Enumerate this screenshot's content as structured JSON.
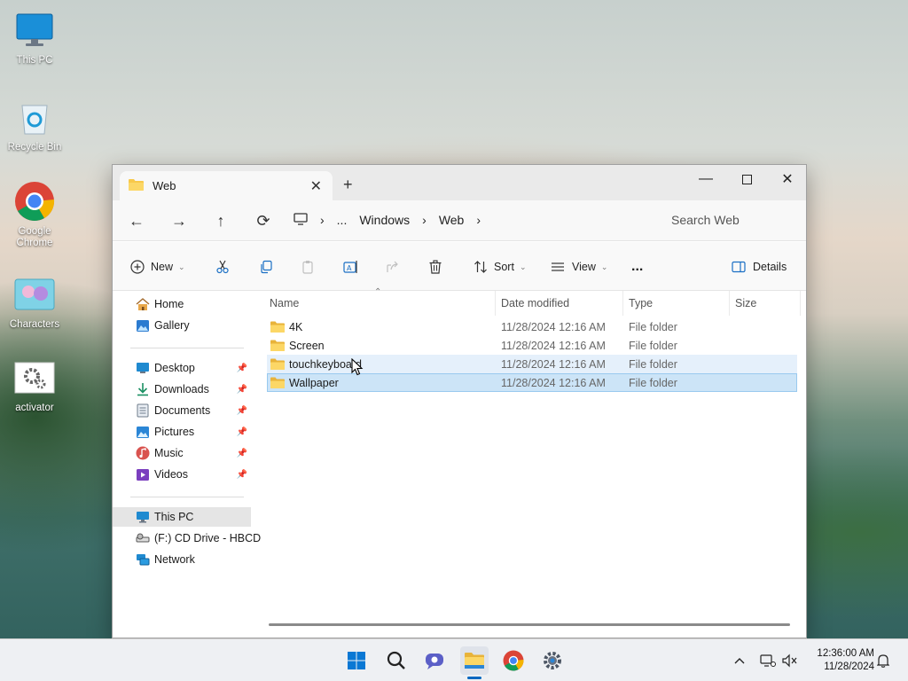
{
  "desktop": {
    "icons": [
      {
        "label": "This PC"
      },
      {
        "label": "Recycle Bin"
      },
      {
        "label": "Google Chrome"
      },
      {
        "label": "Characters"
      },
      {
        "label": "activator"
      }
    ]
  },
  "window": {
    "tab_title": "Web",
    "icons": {
      "folder": "folder-icon",
      "close": "close-icon",
      "new_tab": "plus-icon"
    }
  },
  "address": {
    "crumbs": [
      "...",
      "Windows",
      "Web"
    ],
    "search_placeholder": "Search Web"
  },
  "toolbar": {
    "new_label": "New",
    "sort_label": "Sort",
    "view_label": "View",
    "more_label": "...",
    "details_label": "Details"
  },
  "nav": {
    "home": "Home",
    "gallery": "Gallery",
    "desktop": "Desktop",
    "downloads": "Downloads",
    "documents": "Documents",
    "pictures": "Pictures",
    "music": "Music",
    "videos": "Videos",
    "this_pc": "This PC",
    "cd_drive": "(F:) CD Drive - HBCD",
    "network": "Network"
  },
  "columns": {
    "name": "Name",
    "date": "Date modified",
    "type": "Type",
    "size": "Size"
  },
  "files": [
    {
      "name": "4K",
      "date": "11/28/2024 12:16 AM",
      "type": "File folder"
    },
    {
      "name": "Screen",
      "date": "11/28/2024 12:16 AM",
      "type": "File folder"
    },
    {
      "name": "touchkeyboard",
      "date": "11/28/2024 12:16 AM",
      "type": "File folder"
    },
    {
      "name": "Wallpaper",
      "date": "11/28/2024 12:16 AM",
      "type": "File folder"
    }
  ],
  "taskbar": {
    "time": "12:36:00 AM",
    "date": "11/28/2024"
  },
  "colors": {
    "accent": "#0067c0",
    "folder": "#f8c94a",
    "selection": "#cce4f7"
  }
}
